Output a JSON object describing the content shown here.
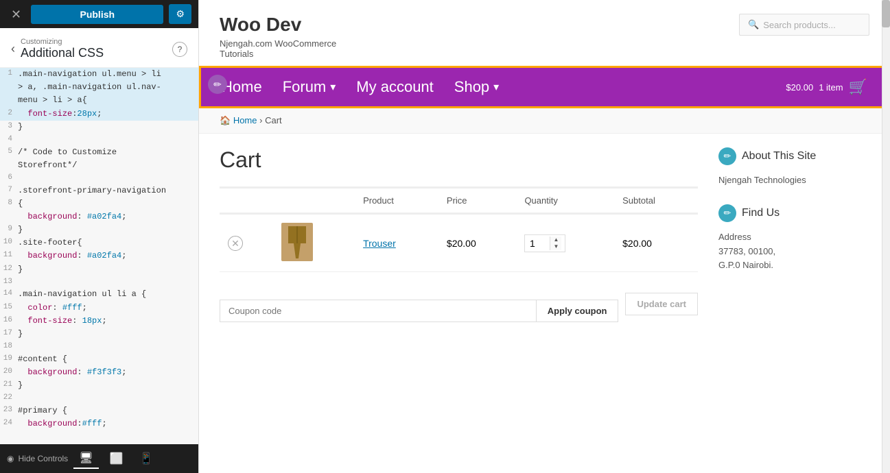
{
  "topbar": {
    "close_label": "✕",
    "publish_label": "Publish",
    "settings_icon": "⚙"
  },
  "customizer": {
    "customizing_label": "Customizing",
    "panel_title": "Additional CSS",
    "help_label": "?"
  },
  "code_lines": [
    {
      "num": 1,
      "text": ".main-navigation ul.menu > li",
      "highlighted": true
    },
    {
      "num": "",
      "text": "> a, .main-navigation ul.nav-",
      "highlighted": true
    },
    {
      "num": "",
      "text": "menu > li > a{",
      "highlighted": true
    },
    {
      "num": 2,
      "text": "  font-size:28px;",
      "highlighted": true
    },
    {
      "num": 3,
      "text": "}",
      "highlighted": false
    },
    {
      "num": 4,
      "text": "",
      "highlighted": false
    },
    {
      "num": 5,
      "text": "/* Code to Customize",
      "highlighted": false,
      "comment": true
    },
    {
      "num": "",
      "text": "Storefront*/",
      "highlighted": false,
      "comment": true
    },
    {
      "num": 6,
      "text": "",
      "highlighted": false
    },
    {
      "num": 7,
      "text": ".storefront-primary-navigation",
      "highlighted": false
    },
    {
      "num": 8,
      "text": "{",
      "highlighted": false
    },
    {
      "num": "",
      "text": "  background: #a02fa4;",
      "highlighted": false
    },
    {
      "num": 9,
      "text": "}",
      "highlighted": false
    },
    {
      "num": 10,
      "text": ".site-footer{",
      "highlighted": false
    },
    {
      "num": 11,
      "text": "  background: #a02fa4;",
      "highlighted": false
    },
    {
      "num": 12,
      "text": "}",
      "highlighted": false
    },
    {
      "num": 13,
      "text": "",
      "highlighted": false
    },
    {
      "num": 14,
      "text": ".main-navigation ul li a {",
      "highlighted": false
    },
    {
      "num": 15,
      "text": "  color: #fff;",
      "highlighted": false
    },
    {
      "num": 16,
      "text": "  font-size: 18px;",
      "highlighted": false
    },
    {
      "num": 17,
      "text": "}",
      "highlighted": false
    },
    {
      "num": 18,
      "text": "",
      "highlighted": false
    },
    {
      "num": 19,
      "text": "#content {",
      "highlighted": false
    },
    {
      "num": 20,
      "text": "  background: #f3f3f3;",
      "highlighted": false
    },
    {
      "num": 21,
      "text": "}",
      "highlighted": false
    },
    {
      "num": 22,
      "text": "",
      "highlighted": false
    },
    {
      "num": 23,
      "text": "#primary {",
      "highlighted": false
    },
    {
      "num": 24,
      "text": "  background:#fff;",
      "highlighted": false
    }
  ],
  "bottom_bar": {
    "hide_controls": "Hide Controls",
    "desktop_icon": "🖥",
    "tablet_icon": "📱",
    "mobile_icon": "📲"
  },
  "site": {
    "title": "Woo Dev",
    "tagline1": "Njengah.com WooCommerce",
    "tagline2": "Tutorials",
    "search_placeholder": "Search products..."
  },
  "nav": {
    "edit_icon": "✏",
    "items": [
      {
        "label": "Home",
        "has_dropdown": false
      },
      {
        "label": "Forum",
        "has_dropdown": true
      },
      {
        "label": "My account",
        "has_dropdown": false
      },
      {
        "label": "Shop",
        "has_dropdown": true
      }
    ],
    "cart_amount": "$20.00",
    "cart_items": "1 item",
    "cart_icon": "🛒"
  },
  "breadcrumb": {
    "home_label": "Home",
    "separator": "›",
    "current": "Cart"
  },
  "cart": {
    "title": "Cart",
    "table_headers": {
      "product": "Product",
      "price": "Price",
      "quantity": "Quantity",
      "subtotal": "Subtotal"
    },
    "items": [
      {
        "name": "Trouser",
        "price": "$20.00",
        "quantity": 1,
        "subtotal": "$20.00"
      }
    ],
    "coupon_placeholder": "Coupon code",
    "apply_coupon": "Apply coupon",
    "update_cart": "Update cart"
  },
  "sidebar": {
    "widgets": [
      {
        "id": "about",
        "title": "About This Site",
        "icon": "✏",
        "content": "Njengah Technologies"
      },
      {
        "id": "find-us",
        "title": "Find Us",
        "icon": "✏",
        "content_lines": [
          "Address",
          "37783, 00100,",
          "G.P.0 Nairobi."
        ]
      }
    ]
  }
}
